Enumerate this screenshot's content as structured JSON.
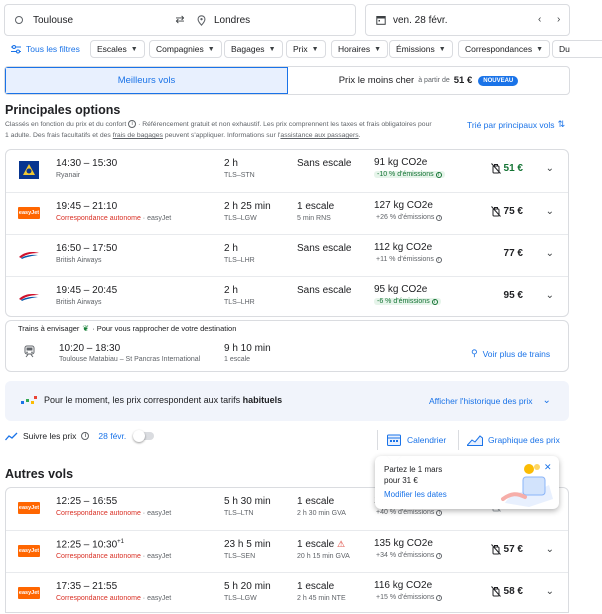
{
  "search": {
    "origin": "Toulouse",
    "destination": "Londres",
    "date": "ven. 28 févr."
  },
  "filters": {
    "all_filters": "Tous les filtres",
    "chips": [
      "Escales",
      "Compagnies",
      "Bagages",
      "Prix",
      "Horaires",
      "Émissions",
      "Correspondances",
      "Du"
    ]
  },
  "sort_tabs": {
    "best": "Meilleurs vols",
    "cheapest": "Prix le moins cher",
    "from_label": "à partir de",
    "from_price": "51 €",
    "new_badge": "NOUVEAU"
  },
  "main": {
    "title": "Principales options",
    "desc_part1": "Classés en fonction du prix et du confort",
    "desc_part2": "· Référencement gratuit et non exhaustif. Les prix comprennent les taxes et frais obligatoires pour",
    "desc_line2_a": "1 adulte. Des frais facultatifs et des",
    "desc_link1": "frais de bagages",
    "desc_line2_b": "peuvent s'appliquer. Informations sur l'",
    "desc_link2": "assistance aux passagers",
    "desc_end": ".",
    "sort_link": "Trié par principaux vols"
  },
  "top_flights": [
    {
      "times": "14:30 – 15:30",
      "airline": "Ryanair",
      "airline_extra": "",
      "duration": "2 h",
      "route": "TLS–STN",
      "stops": "Sans escale",
      "stop_detail": "",
      "co2": "91 kg CO2e",
      "emissions": "-10 % d'émissions",
      "emissions_good": true,
      "price": "51 €",
      "price_green": true,
      "bag_icon": true
    },
    {
      "times": "19:45 – 21:10",
      "airline": "Correspondance autonome",
      "airline_extra": "· easyJet",
      "duration": "2 h 25 min",
      "route": "TLS–LGW",
      "stops": "1 escale",
      "stop_detail": "5 min RNS",
      "co2": "127 kg CO2e",
      "emissions": "+26 % d'émissions",
      "emissions_good": false,
      "price": "75 €",
      "price_green": false,
      "bag_icon": true
    },
    {
      "times": "16:50 – 17:50",
      "airline": "British Airways",
      "airline_extra": "",
      "duration": "2 h",
      "route": "TLS–LHR",
      "stops": "Sans escale",
      "stop_detail": "",
      "co2": "112 kg CO2e",
      "emissions": "+11 % d'émissions",
      "emissions_good": false,
      "price": "77 €",
      "price_green": false,
      "bag_icon": false
    },
    {
      "times": "19:45 – 20:45",
      "airline": "British Airways",
      "airline_extra": "",
      "duration": "2 h",
      "route": "TLS–LHR",
      "stops": "Sans escale",
      "stop_detail": "",
      "co2": "95 kg CO2e",
      "emissions": "-6 % d'émissions",
      "emissions_good": true,
      "price": "95 €",
      "price_green": false,
      "bag_icon": false
    }
  ],
  "trains": {
    "title": "Trains à envisager",
    "subtitle": "· Pour vous rapprocher de votre destination",
    "times": "10:20 – 18:30",
    "stations": "Toulouse Matabiau – St Pancras International",
    "duration": "9 h 10 min",
    "stops": "1 escale",
    "link": "Voir plus de trains"
  },
  "price_insight": {
    "text_a": "Pour le moment, les prix correspondent aux tarifs",
    "text_b": "habituels",
    "link": "Afficher l'historique des prix"
  },
  "track": {
    "label": "Suivre les prix",
    "date": "28 févr.",
    "calendar": "Calendrier",
    "graph": "Graphique des prix"
  },
  "tooltip": {
    "line1": "Partez le 1 mars",
    "line2": "pour 31 €",
    "link": "Modifier les dates"
  },
  "other": {
    "title": "Autres vols"
  },
  "other_flights": [
    {
      "times": "12:25 – 16:55",
      "plus": "",
      "airline": "Correspondance autonome",
      "airline_extra": "· easyJet",
      "duration": "5 h 30 min",
      "route": "TLS–LTN",
      "stops": "1 escale",
      "warn": false,
      "stop_detail": "2 h 30 min GVA",
      "co2": "14",
      "emissions": "+40 % d'émissions",
      "price": "54 €",
      "bag_icon": true
    },
    {
      "times": "12:25 – 10:30",
      "plus": "+1",
      "airline": "Correspondance autonome",
      "airline_extra": "· easyJet",
      "duration": "23 h 5 min",
      "route": "TLS–SEN",
      "stops": "1 escale",
      "warn": true,
      "stop_detail": "20 h 15 min GVA",
      "co2": "135 kg CO2e",
      "emissions": "+34 % d'émissions",
      "price": "57 €",
      "bag_icon": true
    },
    {
      "times": "17:35 – 21:55",
      "plus": "",
      "airline": "Correspondance autonome",
      "airline_extra": "· easyJet",
      "duration": "5 h 20 min",
      "route": "TLS–LGW",
      "stops": "1 escale",
      "warn": false,
      "stop_detail": "2 h 45 min NTE",
      "co2": "116 kg CO2e",
      "emissions": "+15 % d'émissions",
      "price": "58 €",
      "bag_icon": true
    }
  ],
  "colors": {
    "accent": "#1a73e8",
    "selected_tab_bg": "#e8f0fe",
    "ryanair": "#073590",
    "easyjet": "#ff6600",
    "ba_red": "#d0102b",
    "ba_blue": "#075aaa",
    "green": "#137333"
  }
}
